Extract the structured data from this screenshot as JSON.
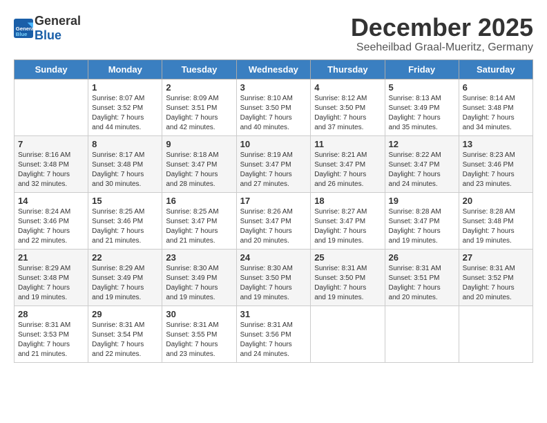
{
  "logo": {
    "general": "General",
    "blue": "Blue"
  },
  "title": "December 2025",
  "subtitle": "Seeheilbad Graal-Mueritz, Germany",
  "days_header": [
    "Sunday",
    "Monday",
    "Tuesday",
    "Wednesday",
    "Thursday",
    "Friday",
    "Saturday"
  ],
  "weeks": [
    [
      {
        "day": "",
        "info": ""
      },
      {
        "day": "1",
        "info": "Sunrise: 8:07 AM\nSunset: 3:52 PM\nDaylight: 7 hours\nand 44 minutes."
      },
      {
        "day": "2",
        "info": "Sunrise: 8:09 AM\nSunset: 3:51 PM\nDaylight: 7 hours\nand 42 minutes."
      },
      {
        "day": "3",
        "info": "Sunrise: 8:10 AM\nSunset: 3:50 PM\nDaylight: 7 hours\nand 40 minutes."
      },
      {
        "day": "4",
        "info": "Sunrise: 8:12 AM\nSunset: 3:50 PM\nDaylight: 7 hours\nand 37 minutes."
      },
      {
        "day": "5",
        "info": "Sunrise: 8:13 AM\nSunset: 3:49 PM\nDaylight: 7 hours\nand 35 minutes."
      },
      {
        "day": "6",
        "info": "Sunrise: 8:14 AM\nSunset: 3:48 PM\nDaylight: 7 hours\nand 34 minutes."
      }
    ],
    [
      {
        "day": "7",
        "info": "Sunrise: 8:16 AM\nSunset: 3:48 PM\nDaylight: 7 hours\nand 32 minutes."
      },
      {
        "day": "8",
        "info": "Sunrise: 8:17 AM\nSunset: 3:48 PM\nDaylight: 7 hours\nand 30 minutes."
      },
      {
        "day": "9",
        "info": "Sunrise: 8:18 AM\nSunset: 3:47 PM\nDaylight: 7 hours\nand 28 minutes."
      },
      {
        "day": "10",
        "info": "Sunrise: 8:19 AM\nSunset: 3:47 PM\nDaylight: 7 hours\nand 27 minutes."
      },
      {
        "day": "11",
        "info": "Sunrise: 8:21 AM\nSunset: 3:47 PM\nDaylight: 7 hours\nand 26 minutes."
      },
      {
        "day": "12",
        "info": "Sunrise: 8:22 AM\nSunset: 3:47 PM\nDaylight: 7 hours\nand 24 minutes."
      },
      {
        "day": "13",
        "info": "Sunrise: 8:23 AM\nSunset: 3:46 PM\nDaylight: 7 hours\nand 23 minutes."
      }
    ],
    [
      {
        "day": "14",
        "info": "Sunrise: 8:24 AM\nSunset: 3:46 PM\nDaylight: 7 hours\nand 22 minutes."
      },
      {
        "day": "15",
        "info": "Sunrise: 8:25 AM\nSunset: 3:46 PM\nDaylight: 7 hours\nand 21 minutes."
      },
      {
        "day": "16",
        "info": "Sunrise: 8:25 AM\nSunset: 3:47 PM\nDaylight: 7 hours\nand 21 minutes."
      },
      {
        "day": "17",
        "info": "Sunrise: 8:26 AM\nSunset: 3:47 PM\nDaylight: 7 hours\nand 20 minutes."
      },
      {
        "day": "18",
        "info": "Sunrise: 8:27 AM\nSunset: 3:47 PM\nDaylight: 7 hours\nand 19 minutes."
      },
      {
        "day": "19",
        "info": "Sunrise: 8:28 AM\nSunset: 3:47 PM\nDaylight: 7 hours\nand 19 minutes."
      },
      {
        "day": "20",
        "info": "Sunrise: 8:28 AM\nSunset: 3:48 PM\nDaylight: 7 hours\nand 19 minutes."
      }
    ],
    [
      {
        "day": "21",
        "info": "Sunrise: 8:29 AM\nSunset: 3:48 PM\nDaylight: 7 hours\nand 19 minutes."
      },
      {
        "day": "22",
        "info": "Sunrise: 8:29 AM\nSunset: 3:49 PM\nDaylight: 7 hours\nand 19 minutes."
      },
      {
        "day": "23",
        "info": "Sunrise: 8:30 AM\nSunset: 3:49 PM\nDaylight: 7 hours\nand 19 minutes."
      },
      {
        "day": "24",
        "info": "Sunrise: 8:30 AM\nSunset: 3:50 PM\nDaylight: 7 hours\nand 19 minutes."
      },
      {
        "day": "25",
        "info": "Sunrise: 8:31 AM\nSunset: 3:50 PM\nDaylight: 7 hours\nand 19 minutes."
      },
      {
        "day": "26",
        "info": "Sunrise: 8:31 AM\nSunset: 3:51 PM\nDaylight: 7 hours\nand 20 minutes."
      },
      {
        "day": "27",
        "info": "Sunrise: 8:31 AM\nSunset: 3:52 PM\nDaylight: 7 hours\nand 20 minutes."
      }
    ],
    [
      {
        "day": "28",
        "info": "Sunrise: 8:31 AM\nSunset: 3:53 PM\nDaylight: 7 hours\nand 21 minutes."
      },
      {
        "day": "29",
        "info": "Sunrise: 8:31 AM\nSunset: 3:54 PM\nDaylight: 7 hours\nand 22 minutes."
      },
      {
        "day": "30",
        "info": "Sunrise: 8:31 AM\nSunset: 3:55 PM\nDaylight: 7 hours\nand 23 minutes."
      },
      {
        "day": "31",
        "info": "Sunrise: 8:31 AM\nSunset: 3:56 PM\nDaylight: 7 hours\nand 24 minutes."
      },
      {
        "day": "",
        "info": ""
      },
      {
        "day": "",
        "info": ""
      },
      {
        "day": "",
        "info": ""
      }
    ]
  ]
}
